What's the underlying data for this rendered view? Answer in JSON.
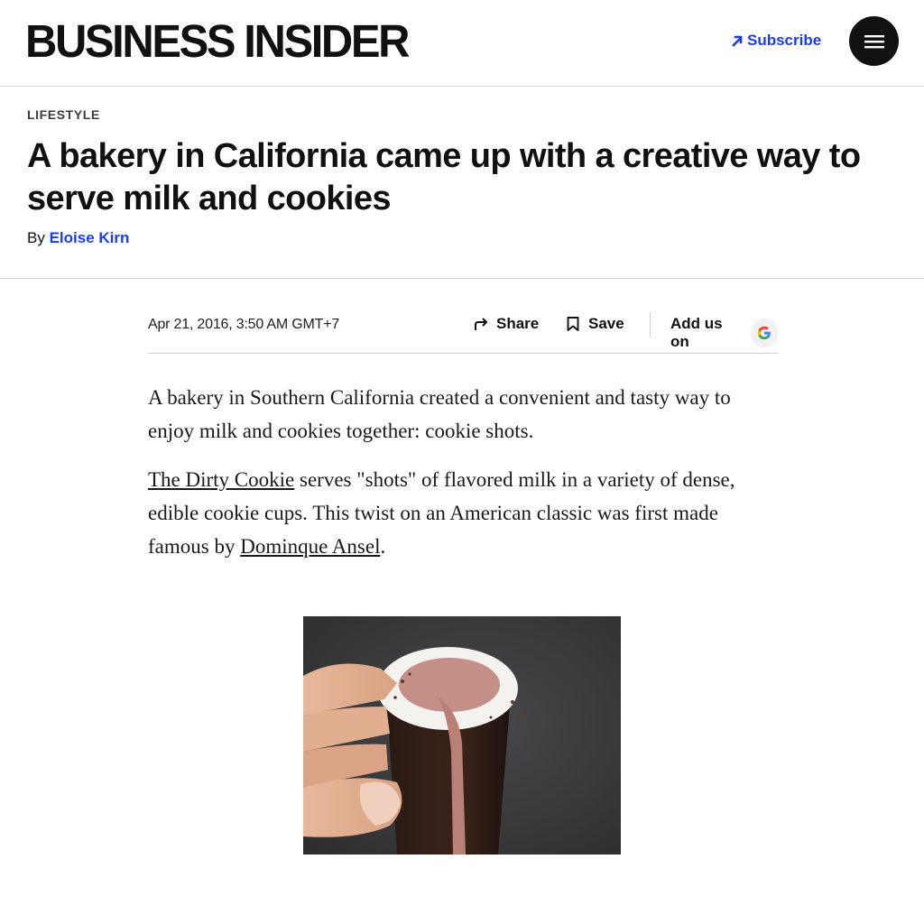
{
  "header": {
    "logo": "BUSINESS INSIDER",
    "subscribe_label": "Subscribe",
    "accent_color": "#1a3cf0"
  },
  "article": {
    "category": "LIFESTYLE",
    "headline": "A bakery in California came up with a creative way to serve milk and cookies",
    "byline_prefix": "By",
    "author": "Eloise Kirn",
    "date": "Apr 21, 2016, 3:50 AM GMT+7",
    "actions": {
      "share_label": "Share",
      "save_label": "Save",
      "add_us_label": "Add us on",
      "google_glyph": "G"
    },
    "paragraph1": "A bakery in Southern California created a convenient and tasty way to enjoy milk and cookies together: cookie shots.",
    "paragraph2": {
      "link1": "The Dirty Cookie",
      "text1": " serves \"shots\" of flavored milk in a variety of dense, edible cookie cups. This twist on an American classic was first made famous by ",
      "link2": "Dominque Ansel",
      "text2": "."
    }
  },
  "icons": {
    "subscribe": "arrow-up-right-icon",
    "menu": "hamburger-menu-icon",
    "share": "share-arrow-icon",
    "save": "bookmark-icon",
    "google": "google-icon"
  }
}
